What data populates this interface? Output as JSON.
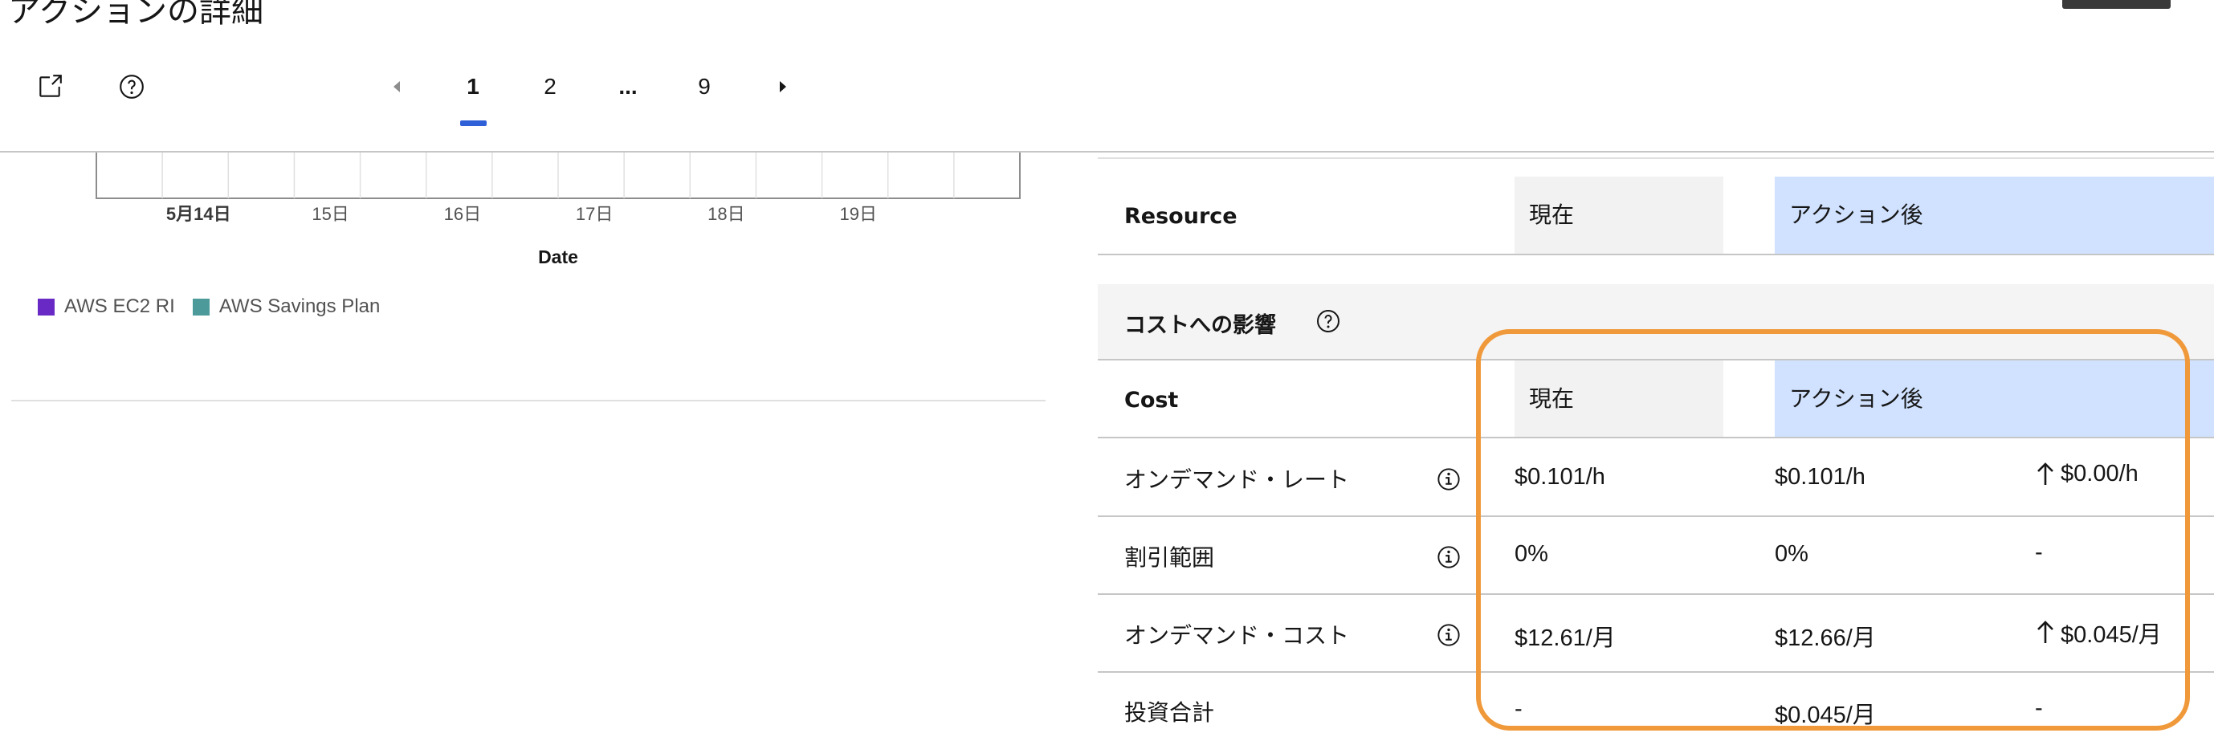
{
  "header": {
    "title": "アクションの詳細",
    "pagination": {
      "pages": [
        "1",
        "2",
        "...",
        "9"
      ],
      "current": "1"
    }
  },
  "icons": {
    "launch": "launch-icon",
    "help": "help-icon",
    "prev": "caret-left-icon",
    "next": "caret-right-icon",
    "info": "info-icon",
    "up_arrow": "arrow-up-icon"
  },
  "chart_data": {
    "type": "bar",
    "categories": [
      "5月14日",
      "15日",
      "16日",
      "17日",
      "18日",
      "19日"
    ],
    "xlabel": "Date",
    "ylabel": "",
    "series": [
      {
        "name": "AWS EC2 RI",
        "color": "#6929c4",
        "values": [
          0,
          0,
          0,
          0,
          0,
          0
        ]
      },
      {
        "name": "AWS Savings Plan",
        "color": "#1192e8",
        "values": [
          0,
          0,
          0,
          0,
          0,
          0
        ]
      }
    ],
    "grid": true,
    "legend_position": "bottom-left"
  },
  "legend": {
    "items": [
      {
        "label": "AWS EC2 RI",
        "color": "#6929c4"
      },
      {
        "label": "AWS Savings Plan",
        "color": "#4c9a9a"
      }
    ]
  },
  "resource_section": {
    "label": "Resource",
    "col_current": "現在",
    "col_after": "アクション後"
  },
  "cost_section": {
    "title": "コストへの影響",
    "header_label": "Cost",
    "col_current": "現在",
    "col_after": "アクション後",
    "rows": [
      {
        "label": "オンデマンド・レート",
        "current": "$0.101/h",
        "after": "$0.101/h",
        "delta": "$0.00/h",
        "delta_up": true
      },
      {
        "label": "割引範囲",
        "current": "0%",
        "after": "0%",
        "delta": "-",
        "delta_up": false
      },
      {
        "label": "オンデマンド・コスト",
        "current": "$12.61/月",
        "after": "$12.66/月",
        "delta": "$0.045/月",
        "delta_up": true
      },
      {
        "label": "投資合計",
        "current": "-",
        "after": "$0.045/月",
        "delta": "-",
        "delta_up": false
      }
    ]
  },
  "colors": {
    "accent": "#3060d8",
    "highlight": "#f0993b",
    "after_bg": "#d0e2ff"
  }
}
